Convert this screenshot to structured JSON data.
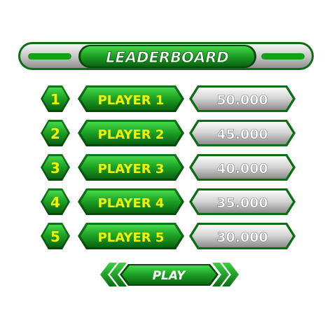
{
  "header": {
    "title": "LEADERBOARD"
  },
  "rows": [
    {
      "rank": "1",
      "name": "PLAYER 1",
      "score": "50.000"
    },
    {
      "rank": "2",
      "name": "PLAYER 2",
      "score": "45.000"
    },
    {
      "rank": "3",
      "name": "PLAYER 3",
      "score": "40.000"
    },
    {
      "rank": "4",
      "name": "PLAYER 4",
      "score": "35.000"
    },
    {
      "rank": "5",
      "name": "PLAYER 5",
      "score": "30.000"
    }
  ],
  "footer": {
    "play_label": "PLAY"
  },
  "icons": {
    "prev": "double-chevron-left-icon",
    "next": "double-chevron-right-icon"
  },
  "colors": {
    "green_dark": "#0c6e12",
    "green_mid": "#1aa321",
    "green_light": "#3ad23f",
    "yellow_text": "#f2f200",
    "silver_light": "#f4f4f4",
    "silver_dark": "#9a9a9a",
    "white_text": "#ffffff"
  }
}
